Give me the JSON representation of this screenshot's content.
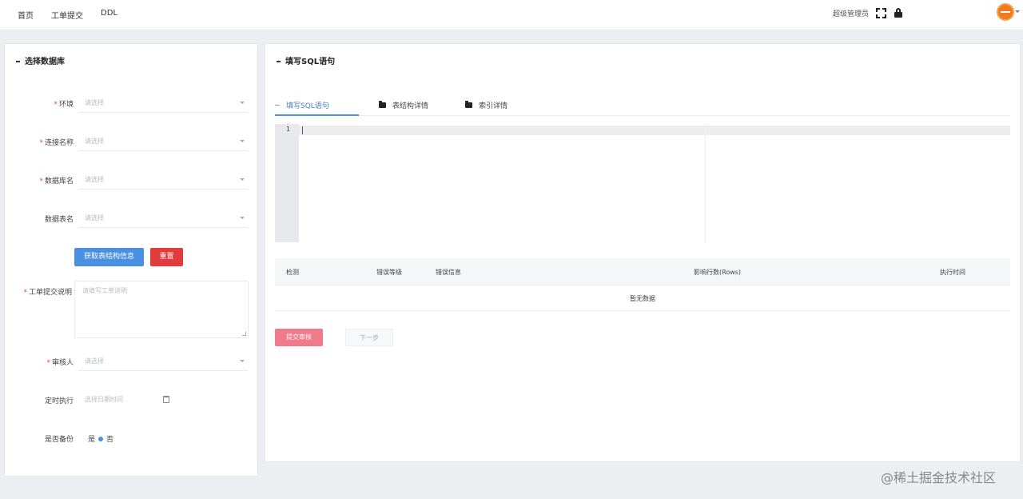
{
  "topbar": {
    "nav": [
      "首页",
      "工单提交",
      "DDL"
    ],
    "user_label": "超级管理员",
    "fullscreen_icon": "fullscreen-icon",
    "lock_icon": "lock-icon",
    "avatar_color": "#f07b1e"
  },
  "left_panel": {
    "title": "选择数据库",
    "fields": [
      {
        "label": "环境",
        "placeholder": "请选择",
        "required": true
      },
      {
        "label": "连接名称",
        "placeholder": "请选择",
        "required": true
      },
      {
        "label": "数据库名",
        "placeholder": "请选择",
        "required": true
      },
      {
        "label": "数据表名",
        "placeholder": "请选择",
        "required": false
      }
    ],
    "buttons": {
      "primary": "获取表结构信息",
      "danger": "重置"
    },
    "description": {
      "label": "工单提交说明",
      "placeholder": "请填写工单说明",
      "required": true
    },
    "approver": {
      "label": "审核人",
      "placeholder": "请选择",
      "required": true
    },
    "schedule": {
      "label": "定时执行",
      "placeholder": "选择日期时间"
    },
    "backup": {
      "label": "是否备份",
      "options": [
        "是",
        "否"
      ],
      "selected": "否"
    }
  },
  "right_panel": {
    "title": "填写SQL语句",
    "tabs": [
      {
        "label": "填写SQL语句",
        "icon": "dash-icon",
        "active": true
      },
      {
        "label": "表结构详情",
        "icon": "folder-icon",
        "active": false
      },
      {
        "label": "索引详情",
        "icon": "folder-icon",
        "active": false
      }
    ],
    "editor": {
      "line_number": "1",
      "content": ""
    },
    "table": {
      "columns": [
        "检测",
        "错误等级",
        "错误信息",
        "影响行数(Rows)",
        "执行时间"
      ],
      "empty_text": "暂无数据"
    },
    "buttons": {
      "submit": "提交审核",
      "next": "下一步"
    }
  },
  "watermark": "@稀土掘金技术社区"
}
